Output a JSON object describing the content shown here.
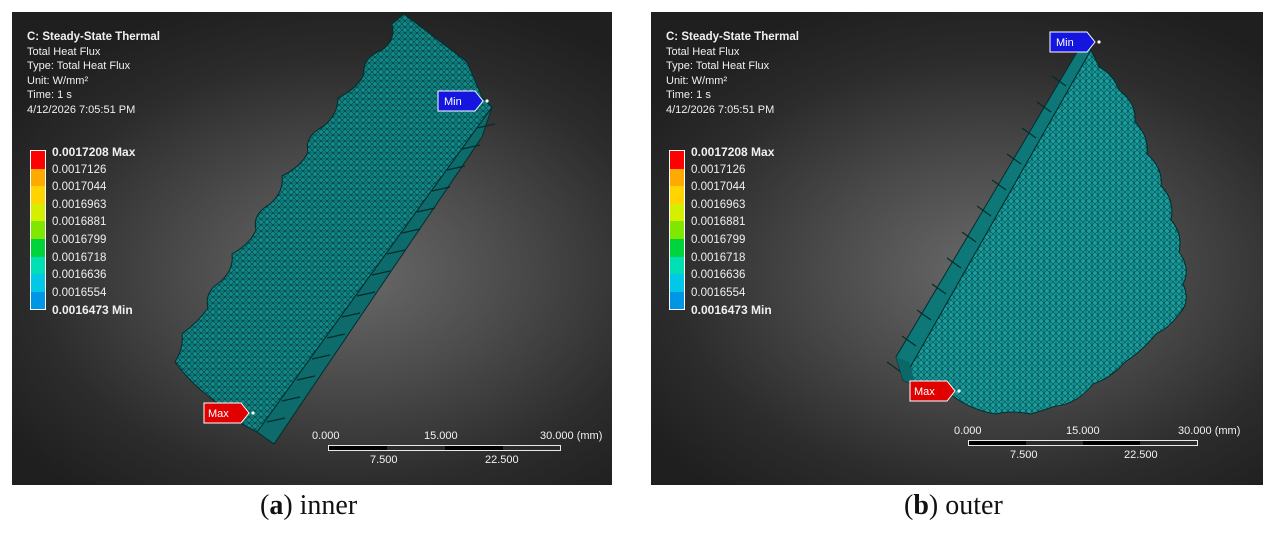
{
  "panels": [
    {
      "title": "C: Steady-State Thermal",
      "result": "Total Heat Flux",
      "type": "Type: Total Heat Flux",
      "unit": "Unit: W/mm²",
      "time": "Time: 1 s",
      "timestamp": "4/12/2026 7:05:51 PM",
      "probe_min": "Min",
      "probe_max": "Max",
      "scale": {
        "ticks_top": [
          "0.000",
          "15.000",
          "30.000 (mm)"
        ],
        "ticks_bottom": [
          "7.500",
          "22.500"
        ]
      },
      "caption_letter": "a",
      "caption_text": "inner"
    },
    {
      "title": "C: Steady-State Thermal",
      "result": "Total Heat Flux",
      "type": "Type: Total Heat Flux",
      "unit": "Unit: W/mm²",
      "time": "Time: 1 s",
      "timestamp": "4/12/2026 7:05:51 PM",
      "probe_min": "Min",
      "probe_max": "Max",
      "scale": {
        "ticks_top": [
          "0.000",
          "15.000",
          "30.000 (mm)"
        ],
        "ticks_bottom": [
          "7.500",
          "22.500"
        ]
      },
      "caption_letter": "b",
      "caption_text": "outer"
    }
  ],
  "legend": {
    "labels": [
      "0.0017208 Max",
      "0.0017126",
      "0.0017044",
      "0.0016963",
      "0.0016881",
      "0.0016799",
      "0.0016718",
      "0.0016636",
      "0.0016554",
      "0.0016473 Min"
    ],
    "colors": [
      "#ff0000",
      "#ffaa00",
      "#ffd400",
      "#d4f000",
      "#80e800",
      "#00d43c",
      "#00e0b4",
      "#00c8e6",
      "#0096e6",
      "#0000ff"
    ]
  },
  "colors": {
    "mesh_fill": "#118a8a",
    "mesh_edge": "#063c3c",
    "min_tag": "#1515e0",
    "max_tag": "#e00000"
  }
}
